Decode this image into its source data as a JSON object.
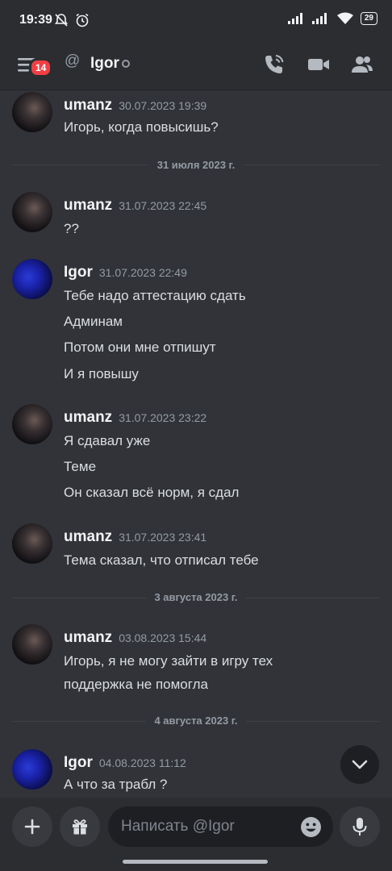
{
  "status_bar": {
    "time": "19:39",
    "battery": "29"
  },
  "header": {
    "badge_count": "14",
    "channel_name": "Igor"
  },
  "dividers": [
    {
      "label": "31 июля 2023 г."
    },
    {
      "label": "3 августа 2023 г."
    },
    {
      "label": "4 августа 2023 г."
    }
  ],
  "messages": [
    {
      "author": "umanz",
      "timestamp": "30.07.2023 19:39",
      "lines": [
        "Игорь, когда повысишь?"
      ]
    },
    {
      "author": "umanz",
      "timestamp": "31.07.2023 22:45",
      "lines": [
        "??"
      ]
    },
    {
      "author": "Igor",
      "timestamp": "31.07.2023 22:49",
      "lines": [
        "Тебе надо аттестацию сдать",
        "Админам",
        "Потом они мне отпишут",
        "И я повышу"
      ]
    },
    {
      "author": "umanz",
      "timestamp": "31.07.2023 23:22",
      "lines": [
        "Я сдавал уже",
        "Теме",
        "Он сказал всё норм, я сдал"
      ]
    },
    {
      "author": "umanz",
      "timestamp": "31.07.2023 23:41",
      "lines": [
        "Тема сказал, что отписал тебе"
      ]
    },
    {
      "author": "umanz",
      "timestamp": "03.08.2023 15:44",
      "lines": [
        "Игорь, я не могу зайти в игру тех",
        "поддержка не помогла"
      ]
    },
    {
      "author": "Igor",
      "timestamp": "04.08.2023 11:12",
      "lines": [
        "А что за трабл ?"
      ]
    }
  ],
  "composer": {
    "placeholder": "Написать @Igor"
  },
  "colors": {
    "background": "#313338",
    "header": "#2b2d31",
    "badge": "#f23f43"
  }
}
